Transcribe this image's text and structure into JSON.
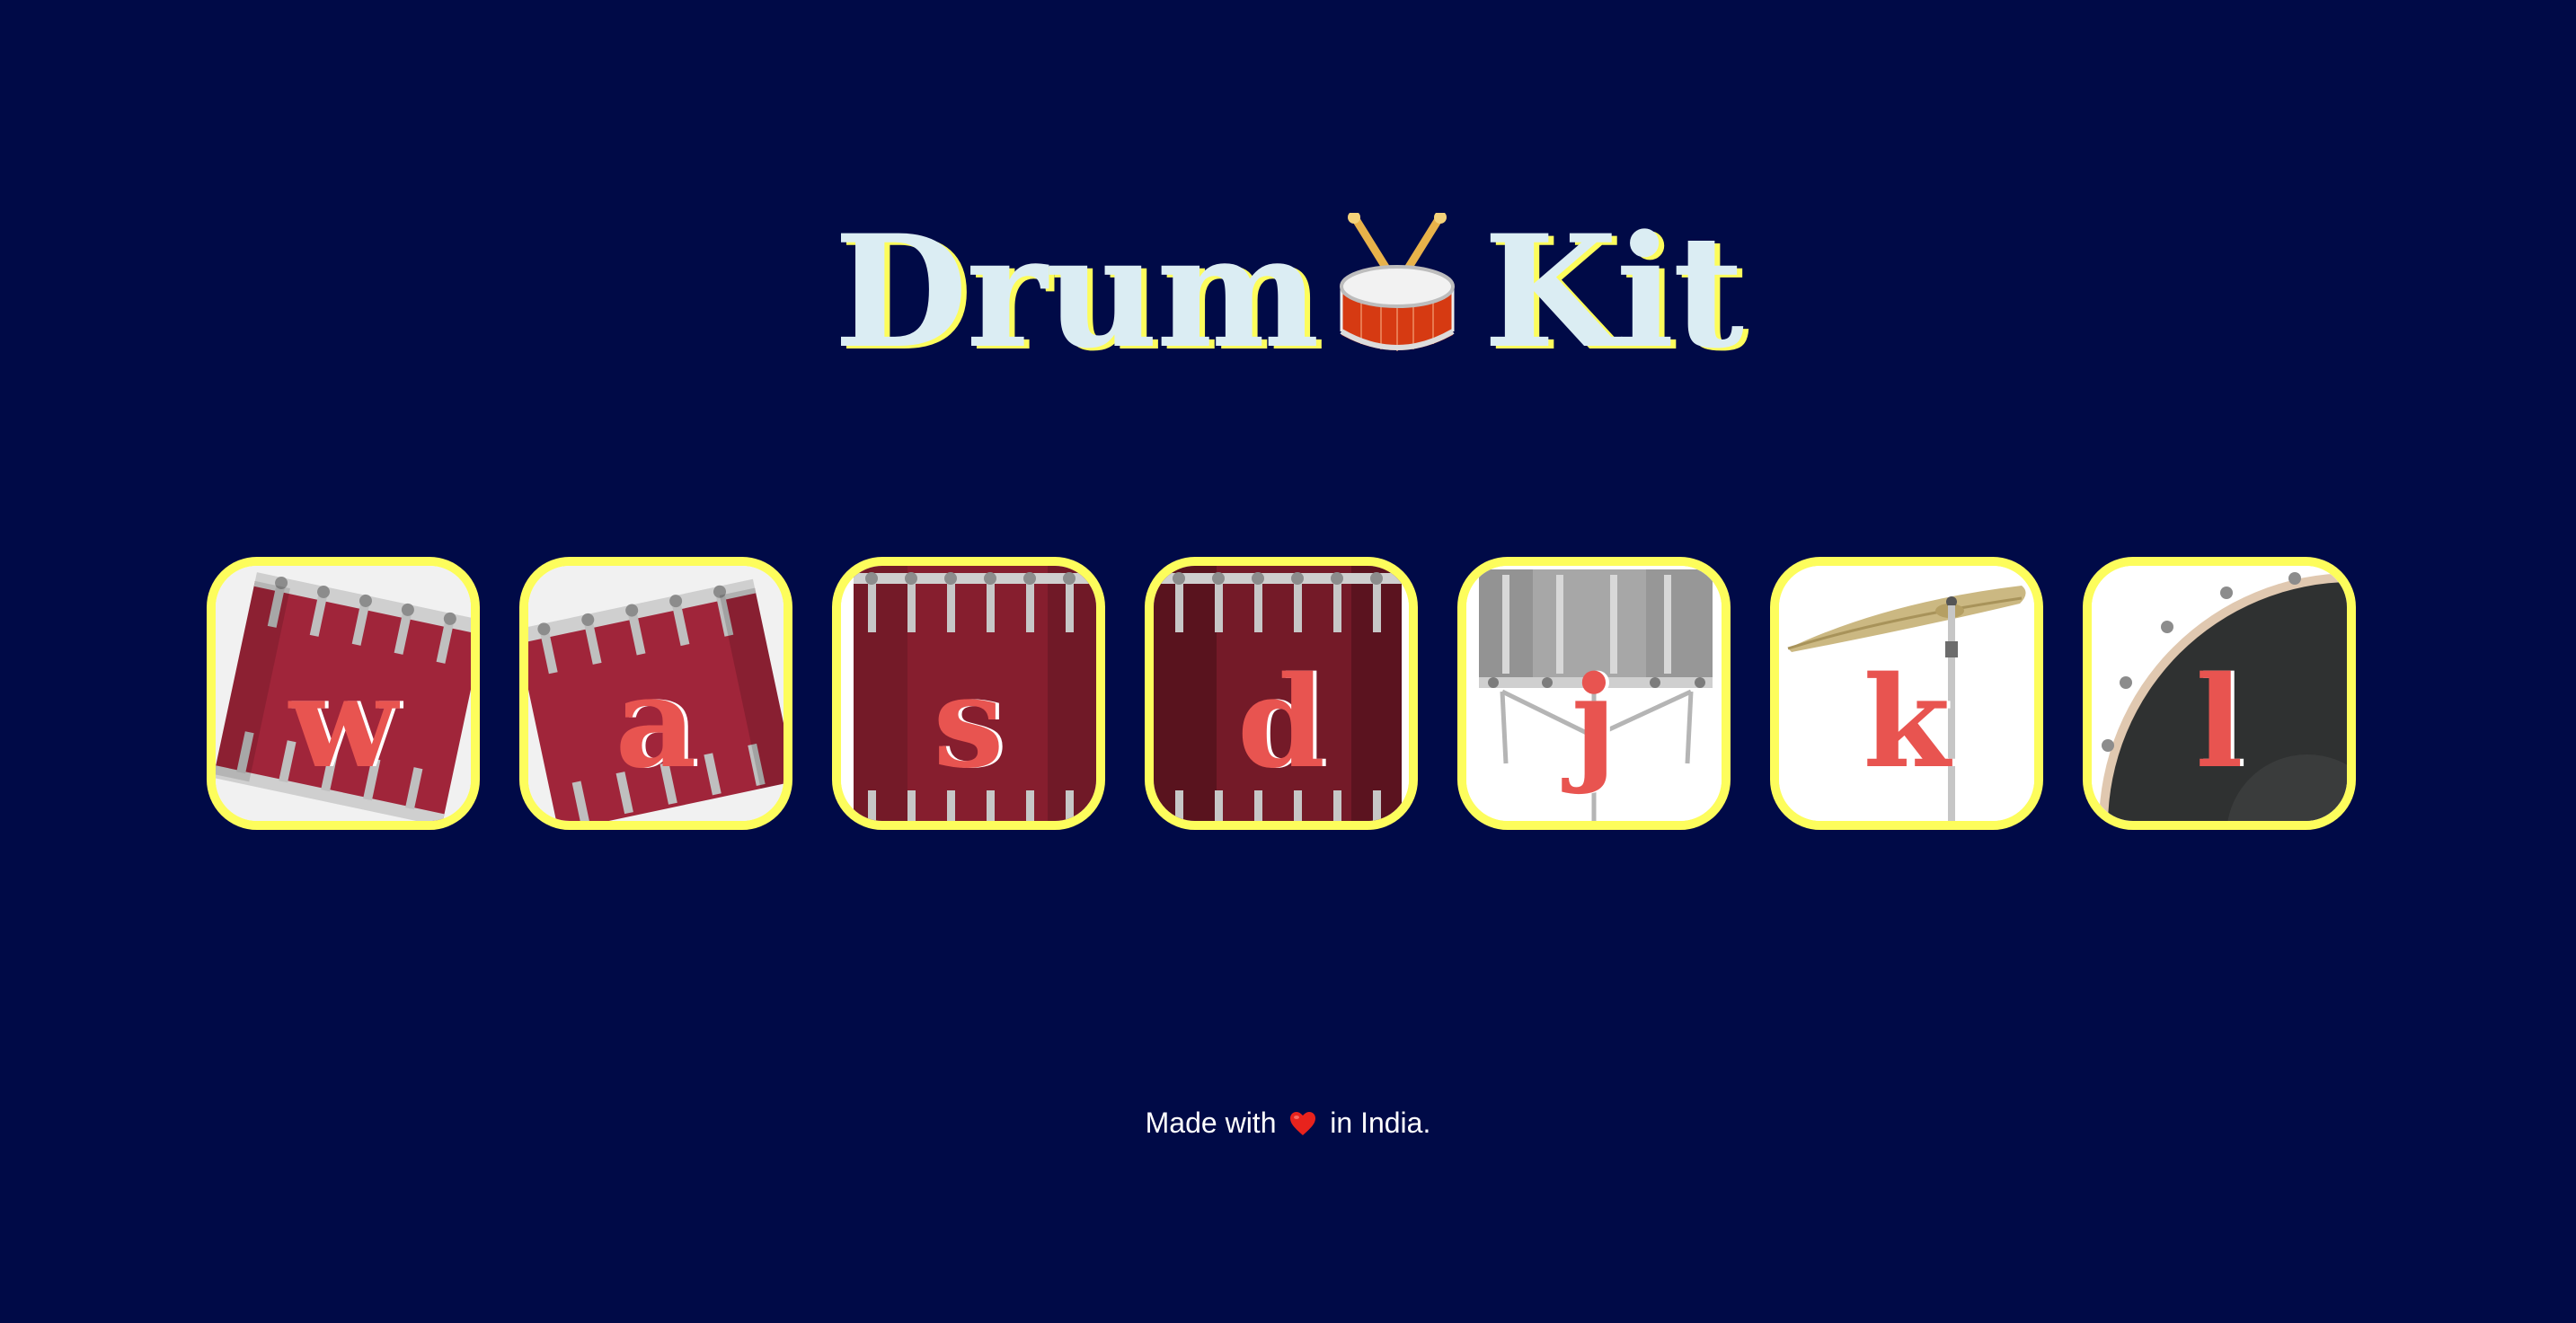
{
  "header": {
    "title_part1": "Drum",
    "title_icon": "drum-with-sticks-emoji",
    "title_part2": "Kit"
  },
  "drums": [
    {
      "key": "w",
      "instrument_icon": "tom-1-tilted",
      "color": "#9b2230"
    },
    {
      "key": "a",
      "instrument_icon": "tom-2-tilted",
      "color": "#9b2230"
    },
    {
      "key": "s",
      "instrument_icon": "tom-3",
      "color": "#7e1e2a"
    },
    {
      "key": "d",
      "instrument_icon": "tom-4",
      "color": "#6e1a25"
    },
    {
      "key": "j",
      "instrument_icon": "snare",
      "color": "#9a9a9a"
    },
    {
      "key": "k",
      "instrument_icon": "crash-cymbal",
      "color": "#c9b680"
    },
    {
      "key": "l",
      "instrument_icon": "kick-bass",
      "color": "#2f3131"
    }
  ],
  "footer": {
    "text_before": "Made with",
    "icon": "heart-icon",
    "text_after": "in India."
  },
  "colors": {
    "background": "#000a47",
    "accent_yellow": "#fdfd5c",
    "key_red": "#e85450",
    "title_text": "#dbedf3"
  }
}
